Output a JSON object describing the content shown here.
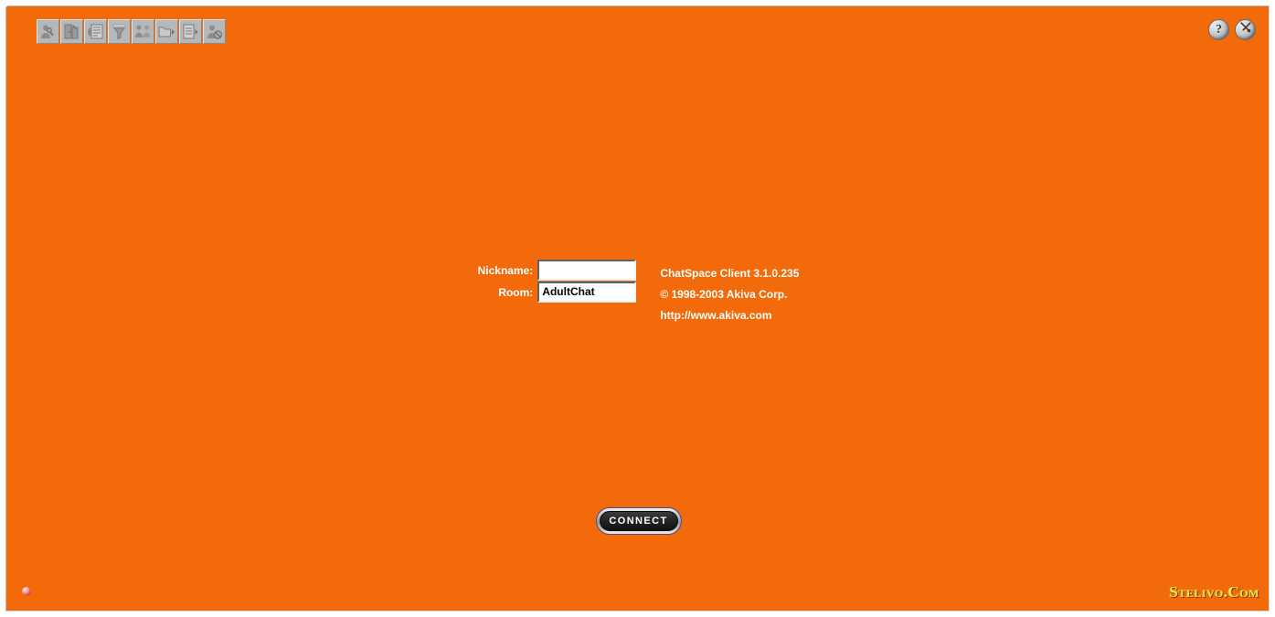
{
  "window": {
    "background_color": "#f26a0a",
    "frame_color": "#ffffff"
  },
  "toolbar": {
    "buttons": [
      {
        "name": "user-settings-icon",
        "tooltip": "User Settings"
      },
      {
        "name": "room-settings-icon",
        "tooltip": "Room Settings"
      },
      {
        "name": "message-list-icon",
        "tooltip": "Messages"
      },
      {
        "name": "filter-icon",
        "tooltip": "Filter"
      },
      {
        "name": "users-icon",
        "tooltip": "Users"
      },
      {
        "name": "folder-menu-icon",
        "tooltip": "Rooms"
      },
      {
        "name": "notepad-menu-icon",
        "tooltip": "Logs"
      },
      {
        "name": "ignore-user-icon",
        "tooltip": "Ignore"
      }
    ]
  },
  "topright": {
    "buttons": [
      {
        "name": "help-icon",
        "glyph": "?",
        "label": "Help"
      },
      {
        "name": "tools-icon",
        "glyph": "⚒",
        "label": "Tools"
      }
    ]
  },
  "login": {
    "nickname_label": "Nickname:",
    "nickname_value": "",
    "nickname_placeholder": "",
    "room_label": "Room:",
    "room_value": "AdultChat",
    "room_placeholder": ""
  },
  "info": {
    "line1": "ChatSpace Client 3.1.0.235",
    "line2": "© 1998-2003 Akiva Corp.",
    "line3": "http://www.akiva.com"
  },
  "connect": {
    "label": "CONNECT"
  },
  "status": {
    "indicator_name": "connection-status-light",
    "indicator_color": "#d64b3f"
  },
  "brand": {
    "text": "Stelivo.Com",
    "color": "#f3e24a"
  }
}
